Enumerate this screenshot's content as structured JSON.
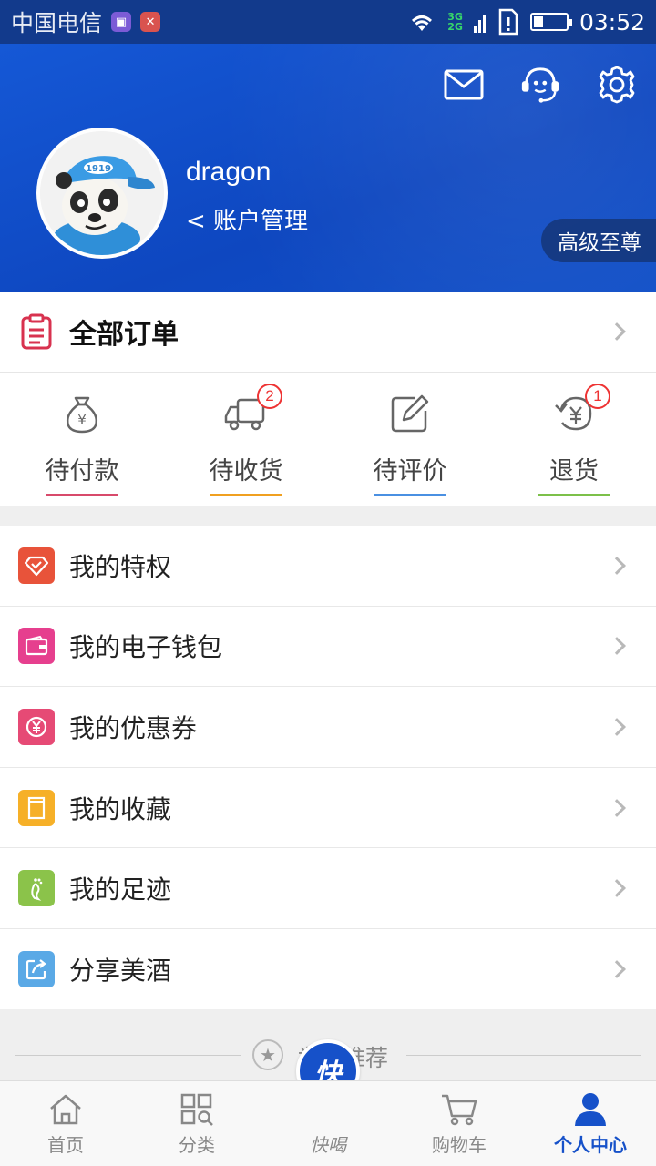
{
  "status_bar": {
    "carrier": "中国电信",
    "network_top": "3G",
    "network_bottom": "2G",
    "time": "03:52"
  },
  "header": {
    "username": "dragon",
    "account_link": "< 账户管理",
    "level_badge": "高级至尊",
    "icons": [
      "mail-icon",
      "customer-service-icon",
      "settings-icon"
    ]
  },
  "orders": {
    "title": "全部订单",
    "statuses": [
      {
        "label": "待付款",
        "icon": "money-bag-icon",
        "badge": "",
        "color": "#d84a6b"
      },
      {
        "label": "待收货",
        "icon": "delivery-truck-icon",
        "badge": "2",
        "color": "#f0a020"
      },
      {
        "label": "待评价",
        "icon": "edit-review-icon",
        "badge": "",
        "color": "#4a90e2"
      },
      {
        "label": "退货",
        "icon": "return-icon",
        "badge": "1",
        "color": "#7cc04a"
      }
    ]
  },
  "menu": [
    {
      "label": "我的特权",
      "icon": "privilege-icon",
      "color": "#e8533a"
    },
    {
      "label": "我的电子钱包",
      "icon": "wallet-icon",
      "color": "#e63f8e"
    },
    {
      "label": "我的优惠券",
      "icon": "coupon-icon",
      "color": "#e64a75"
    },
    {
      "label": "我的收藏",
      "icon": "favorites-icon",
      "color": "#f6b028"
    },
    {
      "label": "我的足迹",
      "icon": "footprint-icon",
      "color": "#8bc34a"
    },
    {
      "label": "分享美酒",
      "icon": "share-icon",
      "color": "#5aa9e6"
    }
  ],
  "recommend": {
    "title": "为您推荐"
  },
  "tabbar": {
    "tabs": [
      {
        "label": "首页",
        "icon": "home-icon"
      },
      {
        "label": "分类",
        "icon": "category-icon"
      },
      {
        "label": "快喝",
        "icon": "quick-drink-icon"
      },
      {
        "label": "购物车",
        "icon": "cart-icon"
      },
      {
        "label": "个人中心",
        "icon": "profile-icon"
      }
    ],
    "fab_label": "快",
    "active_color": "#1651c9"
  }
}
